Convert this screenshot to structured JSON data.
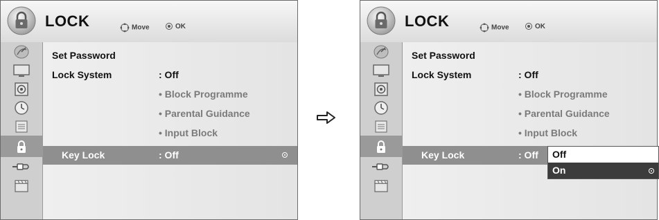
{
  "header": {
    "title": "LOCK",
    "move_hint": "Move",
    "ok_hint": "OK"
  },
  "sidebar": {
    "items": [
      {
        "icon": "satellite-dish-icon"
      },
      {
        "icon": "monitor-icon"
      },
      {
        "icon": "speaker-icon"
      },
      {
        "icon": "clock-icon"
      },
      {
        "icon": "options-icon"
      },
      {
        "icon": "lock-icon",
        "active": true
      },
      {
        "icon": "input-plug-icon"
      },
      {
        "icon": "clapperboard-icon"
      }
    ]
  },
  "menu": {
    "set_password": "Set Password",
    "lock_system": {
      "label": "Lock System",
      "value": ": Off"
    },
    "sub_items": [
      "• Block Programme",
      "• Parental Guidance",
      "• Input Block"
    ],
    "key_lock": {
      "label": "Key Lock",
      "value": ": Off"
    }
  },
  "dropdown": {
    "options": [
      "Off",
      "On"
    ],
    "highlighted": "On"
  },
  "colors": {
    "selected_row": "#8f8f8f",
    "dropdown_highlight": "#3c3c3c"
  }
}
